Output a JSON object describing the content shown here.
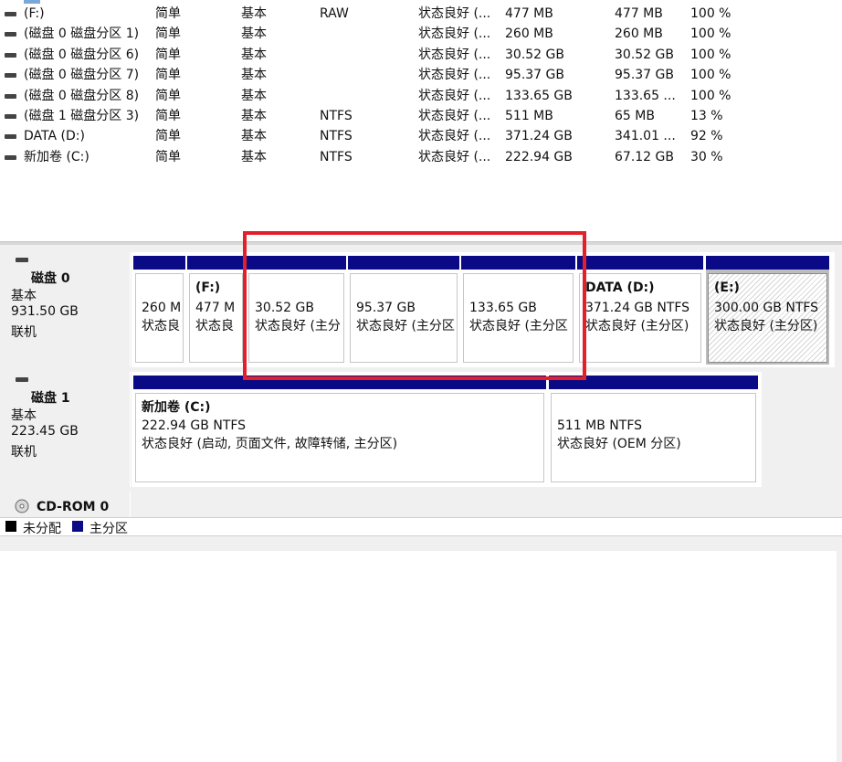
{
  "volumes": [
    {
      "name": "(F:)",
      "layout": "简单",
      "type": "基本",
      "fs": "RAW",
      "status": "状态良好 (...",
      "capacity": "477 MB",
      "free": "477 MB",
      "pct": "100 %"
    },
    {
      "name": "(磁盘 0 磁盘分区 1)",
      "layout": "简单",
      "type": "基本",
      "fs": "",
      "status": "状态良好 (...",
      "capacity": "260 MB",
      "free": "260 MB",
      "pct": "100 %"
    },
    {
      "name": "(磁盘 0 磁盘分区 6)",
      "layout": "简单",
      "type": "基本",
      "fs": "",
      "status": "状态良好 (...",
      "capacity": "30.52 GB",
      "free": "30.52 GB",
      "pct": "100 %"
    },
    {
      "name": "(磁盘 0 磁盘分区 7)",
      "layout": "简单",
      "type": "基本",
      "fs": "",
      "status": "状态良好 (...",
      "capacity": "95.37 GB",
      "free": "95.37 GB",
      "pct": "100 %"
    },
    {
      "name": "(磁盘 0 磁盘分区 8)",
      "layout": "简单",
      "type": "基本",
      "fs": "",
      "status": "状态良好 (...",
      "capacity": "133.65 GB",
      "free": "133.65 ...",
      "pct": "100 %"
    },
    {
      "name": "(磁盘 1 磁盘分区 3)",
      "layout": "简单",
      "type": "基本",
      "fs": "NTFS",
      "status": "状态良好 (...",
      "capacity": "511 MB",
      "free": "65 MB",
      "pct": "13 %"
    },
    {
      "name": "DATA (D:)",
      "layout": "简单",
      "type": "基本",
      "fs": "NTFS",
      "status": "状态良好 (...",
      "capacity": "371.24 GB",
      "free": "341.01 ...",
      "pct": "92 %"
    },
    {
      "name": "新加卷 (C:)",
      "layout": "简单",
      "type": "基本",
      "fs": "NTFS",
      "status": "状态良好 (...",
      "capacity": "222.94 GB",
      "free": "67.12 GB",
      "pct": "30 %"
    }
  ],
  "disks": [
    {
      "name": "磁盘 0",
      "type": "基本",
      "size": "931.50 GB",
      "state": "联机",
      "partitions": [
        {
          "title": "",
          "size": "260 M",
          "status": "状态良"
        },
        {
          "title": "(F:)",
          "size": "477 M",
          "status": "状态良"
        },
        {
          "title": "",
          "size": "30.52 GB",
          "status": "状态良好 (主分"
        },
        {
          "title": "",
          "size": "95.37 GB",
          "status": "状态良好 (主分区"
        },
        {
          "title": "",
          "size": "133.65 GB",
          "status": "状态良好 (主分区"
        },
        {
          "title": "DATA  (D:)",
          "size": "371.24 GB NTFS",
          "status": "状态良好 (主分区)"
        },
        {
          "title": "(E:)",
          "size": "300.00 GB NTFS",
          "status": "状态良好 (主分区)"
        }
      ]
    },
    {
      "name": "磁盘 1",
      "type": "基本",
      "size": "223.45 GB",
      "state": "联机",
      "partitions": [
        {
          "title": "新加卷  (C:)",
          "size": "222.94 GB NTFS",
          "status": "状态良好 (启动, 页面文件, 故障转储, 主分区)"
        },
        {
          "title": "",
          "size": "511 MB NTFS",
          "status": "状态良好 (OEM 分区)"
        }
      ]
    },
    {
      "name": "CD-ROM 0"
    }
  ],
  "legend": {
    "unallocated": "未分配",
    "primary": "主分区"
  },
  "colors": {
    "primary": "#0a0a86",
    "unallocated": "#000000",
    "highlight": "#e1202a"
  }
}
